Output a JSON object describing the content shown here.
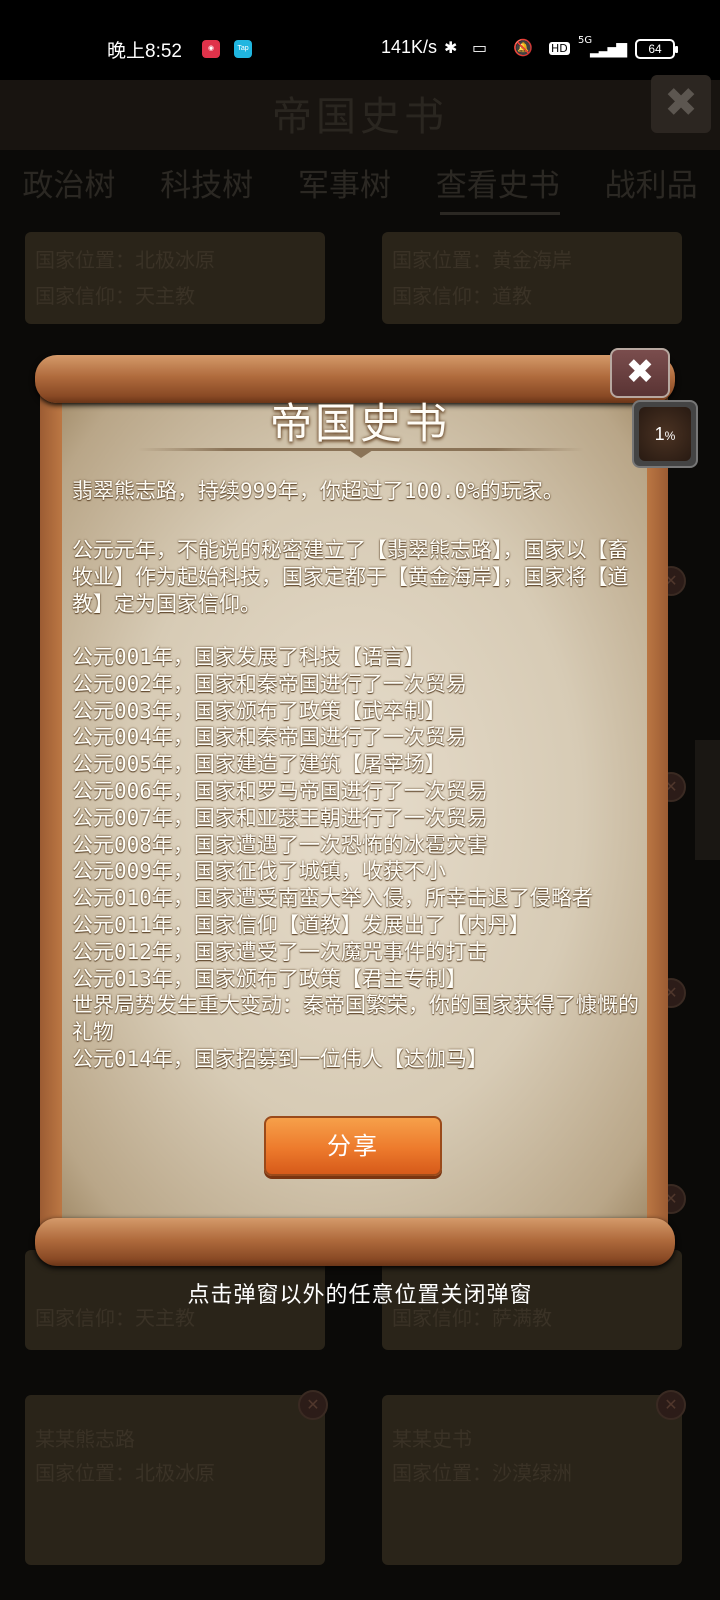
{
  "status_bar": {
    "time": "晚上8:52",
    "network_speed": "141K/s",
    "network_type": "5G",
    "battery": "64",
    "icons": [
      "app-icon-red",
      "app-icon-tap",
      "bluetooth-icon",
      "vibrate-icon",
      "mute-icon",
      "hd-icon",
      "signal-icon"
    ]
  },
  "background": {
    "header_title": "帝国史书",
    "tabs": [
      "政治树",
      "科技树",
      "军事树",
      "查看史书",
      "战利品"
    ],
    "active_tab": "查看史书",
    "cards": [
      {
        "line1": "国家位置：北极冰原",
        "line2": "国家信仰：天主教"
      },
      {
        "line1": "国家位置：黄金海岸",
        "line2": "国家信仰：道教"
      },
      {
        "line1": "",
        "line2": "国家信仰：天主教"
      },
      {
        "line1": "",
        "line2": "国家信仰：萨满教"
      },
      {
        "line1": "某某熊志路",
        "line2": "国家位置：北极冰原"
      },
      {
        "line1": "某某史书",
        "line2": "国家位置：沙漠绿洲"
      }
    ]
  },
  "dialog": {
    "title": "帝国史书",
    "summary": "翡翠熊志路，持续999年，你超过了100.0%的玩家。",
    "intro": "公元元年，不能说的秘密建立了【翡翠熊志路】，国家以【畜牧业】作为起始科技，国家定都于【黄金海岸】，国家将【道教】定为国家信仰。",
    "events": [
      "公元001年，国家发展了科技【语言】",
      "公元002年，国家和秦帝国进行了一次贸易",
      "公元003年，国家颁布了政策【武卒制】",
      "公元004年，国家和秦帝国进行了一次贸易",
      "公元005年，国家建造了建筑【屠宰场】",
      "公元006年，国家和罗马帝国进行了一次贸易",
      "公元007年，国家和亚瑟王朝进行了一次贸易",
      "公元008年，国家遭遇了一次恐怖的冰雹灾害",
      "公元009年，国家征伐了城镇，收获不小",
      "公元010年，国家遭受南蛮大举入侵，所幸击退了侵略者",
      "公元011年，国家信仰【道教】发展出了【内丹】",
      "公元012年，国家遭受了一次魔咒事件的打击",
      "公元013年，国家颁布了政策【君主专制】",
      "世界局势发生重大变动：秦帝国繁荣，你的国家获得了慷慨的礼物",
      "公元014年，国家招募到一位伟人【达伽马】"
    ],
    "share_label": "分享"
  },
  "progress": {
    "value": "1",
    "unit": "%"
  },
  "hint": "点击弹窗以外的任意位置关闭弹窗"
}
